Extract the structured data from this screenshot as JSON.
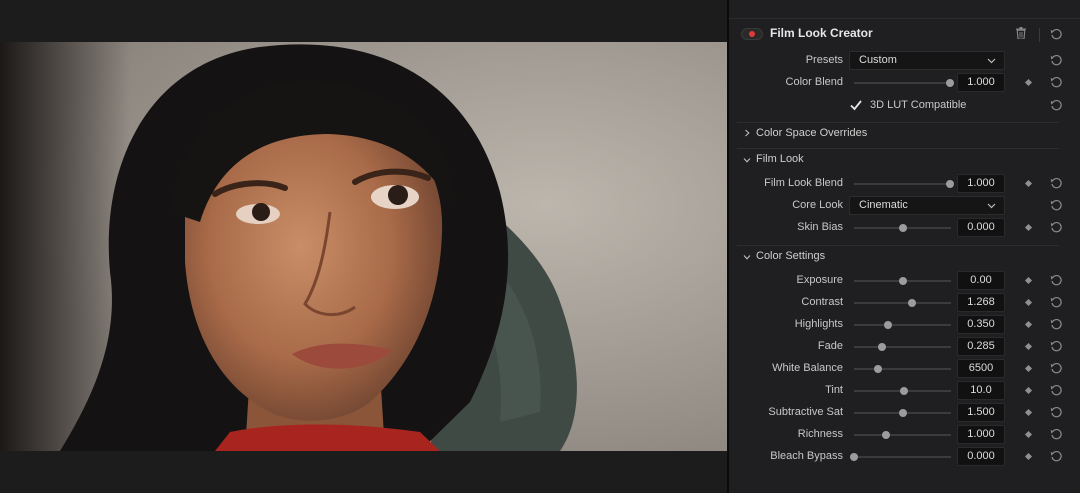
{
  "effect": {
    "title": "Film Look Creator",
    "enabled": true,
    "accent_color": "#e03a3a"
  },
  "top_controls": {
    "presets": {
      "label": "Presets",
      "value": "Custom"
    },
    "color_blend": {
      "label": "Color Blend",
      "value": "1.000",
      "level": 0.99
    },
    "lut_compatible": {
      "label": "3D LUT Compatible",
      "checked": true
    }
  },
  "sections": {
    "color_space_overrides": {
      "title": "Color Space Overrides",
      "expanded": false
    },
    "film_look": {
      "title": "Film Look",
      "expanded": true
    },
    "color_settings": {
      "title": "Color Settings",
      "expanded": true
    }
  },
  "film_look": {
    "film_look_blend": {
      "label": "Film Look Blend",
      "value": "1.000",
      "level": 0.99
    },
    "core_look": {
      "label": "Core Look",
      "value": "Cinematic"
    },
    "skin_bias": {
      "label": "Skin Bias",
      "value": "0.000",
      "level": 0.5
    }
  },
  "color_settings": [
    {
      "label": "Exposure",
      "value": "0.00",
      "level": 0.5
    },
    {
      "label": "Contrast",
      "value": "1.268",
      "level": 0.6
    },
    {
      "label": "Highlights",
      "value": "0.350",
      "level": 0.35
    },
    {
      "label": "Fade",
      "value": "0.285",
      "level": 0.29
    },
    {
      "label": "White Balance",
      "value": "6500",
      "level": 0.25
    },
    {
      "label": "Tint",
      "value": "10.0",
      "level": 0.52
    },
    {
      "label": "Subtractive Sat",
      "value": "1.500",
      "level": 0.5
    },
    {
      "label": "Richness",
      "value": "1.000",
      "level": 0.33
    },
    {
      "label": "Bleach Bypass",
      "value": "0.000",
      "level": 0.0
    }
  ],
  "icons": {
    "trash": "trash-icon",
    "reset": "reset-icon",
    "keyframe": "keyframe-diamond-icon",
    "dropdown": "chevron-down-icon",
    "section_expanded": "chevron-down-icon",
    "section_collapsed": "chevron-right-icon"
  }
}
